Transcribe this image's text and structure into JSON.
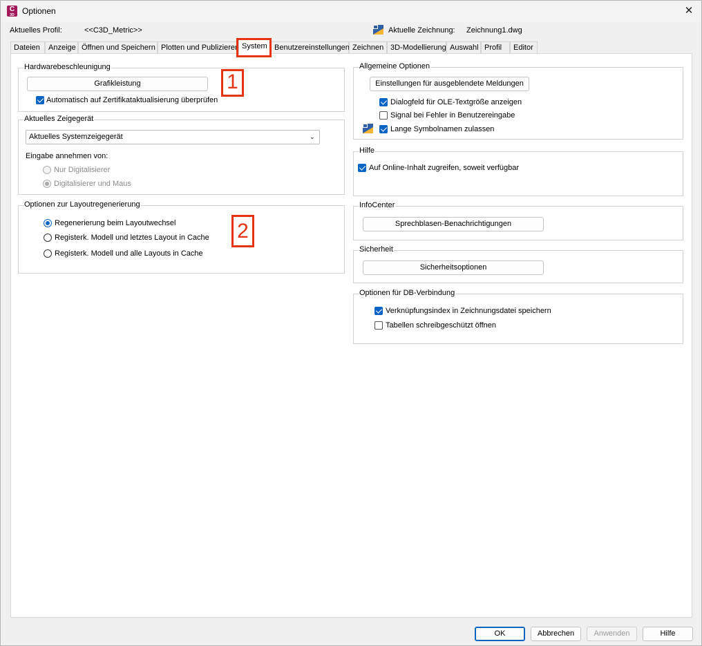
{
  "window": {
    "title": "Optionen",
    "app_icon_letter": "C",
    "app_icon_sub": "3D"
  },
  "profile": {
    "label": "Aktuelles Profil:",
    "value": "<<C3D_Metric>>"
  },
  "drawing": {
    "label": "Aktuelle Zeichnung:",
    "value": "Zeichnung1.dwg"
  },
  "tabs": [
    {
      "label": "Dateien"
    },
    {
      "label": "Anzeige"
    },
    {
      "label": "Öffnen und Speichern"
    },
    {
      "label": "Plotten und Publizieren"
    },
    {
      "label": "System"
    },
    {
      "label": "Benutzereinstellungen"
    },
    {
      "label": "Zeichnen"
    },
    {
      "label": "3D-Modellierung"
    },
    {
      "label": "Auswahl"
    },
    {
      "label": "Profil"
    },
    {
      "label": "Editor"
    }
  ],
  "active_tab": "System",
  "hardware": {
    "title": "Hardwarebeschleunigung",
    "button": "Grafikleistung",
    "checkbox": "Automatisch auf Zertifikataktualisierung überprüfen",
    "checkbox_checked": true
  },
  "pointer": {
    "title": "Aktuelles Zeigegerät",
    "selected": "Aktuelles Systemzeigegerät",
    "input_label": "Eingabe annehmen von:",
    "options": [
      {
        "label": "Nur Digitalisierer",
        "selected": false
      },
      {
        "label": "Digitalisierer und Maus",
        "selected": true
      }
    ]
  },
  "layout_regen": {
    "title": "Optionen zur Layoutregenerierung",
    "options": [
      {
        "label": "Regenerierung beim Layoutwechsel",
        "selected": true
      },
      {
        "label": "Registerk. Modell und letztes Layout in Cache",
        "selected": false
      },
      {
        "label": "Registerk. Modell und alle Layouts in Cache",
        "selected": false
      }
    ]
  },
  "general": {
    "title": "Allgemeine Optionen",
    "button": "Einstellungen für ausgeblendete Meldungen",
    "checkboxes": [
      {
        "label": "Dialogfeld für OLE-Textgröße anzeigen",
        "checked": true
      },
      {
        "label": "Signal bei Fehler in Benutzereingabe",
        "checked": false
      },
      {
        "label": "Lange Symbolnamen zulassen",
        "checked": true
      }
    ]
  },
  "help": {
    "title": "Hilfe",
    "checkbox": "Auf Online-Inhalt zugreifen, soweit verfügbar",
    "checked": true
  },
  "infocenter": {
    "title": "InfoCenter",
    "button": "Sprechblasen-Benachrichtigungen"
  },
  "security": {
    "title": "Sicherheit",
    "button": "Sicherheitsoptionen"
  },
  "dbconnect": {
    "title": "Optionen für DB-Verbindung",
    "checkboxes": [
      {
        "label": "Verknüpfungsindex in Zeichnungsdatei speichern",
        "checked": true
      },
      {
        "label": "Tabellen schreibgeschützt öffnen",
        "checked": false
      }
    ]
  },
  "annotations": {
    "one": "1",
    "two": "2"
  },
  "footer": {
    "ok": "OK",
    "cancel": "Abbrechen",
    "apply": "Anwenden",
    "help": "Hilfe"
  },
  "colors": {
    "accent": "#0a64c4",
    "annotation": "#e63312"
  }
}
